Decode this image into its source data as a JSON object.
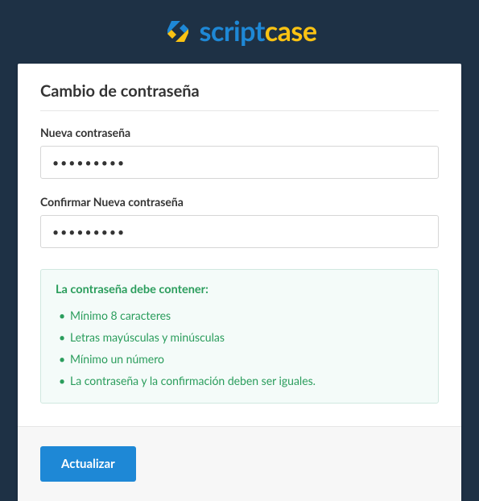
{
  "brand": {
    "part1": "script",
    "part2": "case"
  },
  "form": {
    "title": "Cambio de contraseña",
    "fields": {
      "new_password": {
        "label": "Nueva contraseña",
        "value": "•••••••••"
      },
      "confirm_password": {
        "label": "Confirmar Nueva contraseña",
        "value": "•••••••••"
      }
    },
    "rules": {
      "title": "La contraseña debe contener:",
      "items": [
        "Mínimo 8 caracteres",
        "Letras mayúsculas y minúsculas",
        "Mínimo un número",
        "La contraseña y la confirmación deben ser iguales."
      ]
    },
    "submit_label": "Actualizar"
  }
}
